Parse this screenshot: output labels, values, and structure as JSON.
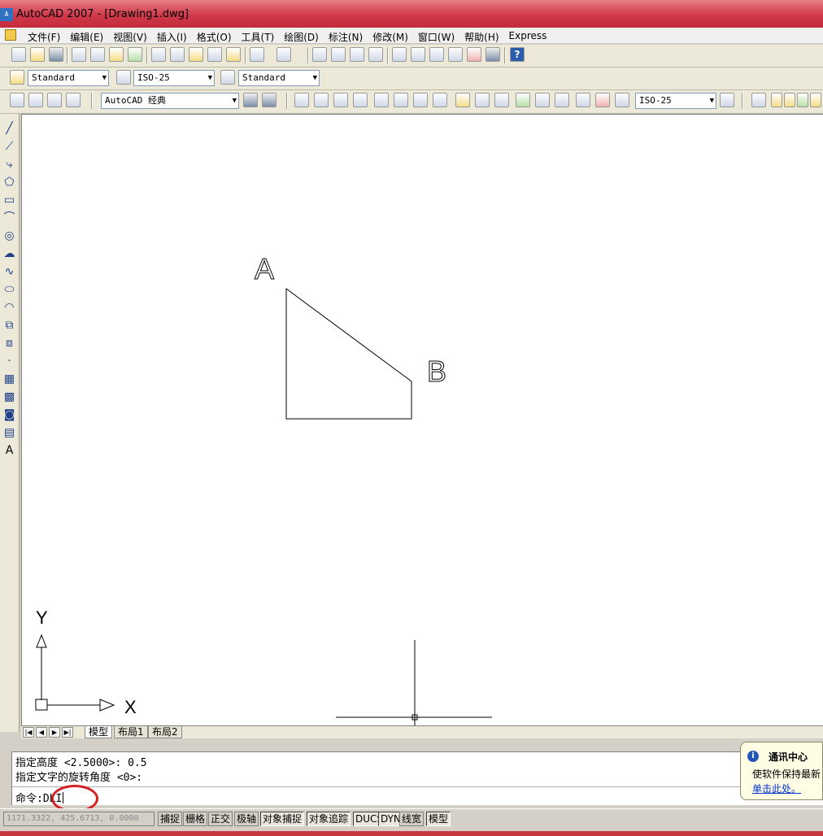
{
  "window": {
    "title": "AutoCAD 2007 - [Drawing1.dwg]",
    "app_icon_text": "A"
  },
  "menu": [
    "文件(F)",
    "编辑(E)",
    "视图(V)",
    "插入(I)",
    "格式(O)",
    "工具(T)",
    "绘图(D)",
    "标注(N)",
    "修改(M)",
    "窗口(W)",
    "帮助(H)",
    "Express"
  ],
  "styles_toolbar": {
    "text_style": "Standard",
    "dim_style": "ISO-25",
    "table_style": "Standard"
  },
  "workspace_toolbar": {
    "workspace": "AutoCAD 经典",
    "dim_style": "ISO-25"
  },
  "help_icon": "?",
  "left_tools": [
    "line-icon",
    "construction-line-icon",
    "polyline-icon",
    "polygon-icon",
    "rectangle-icon",
    "arc-icon",
    "circle-icon",
    "revcloud-icon",
    "spline-icon",
    "ellipse-icon",
    "ellipse-arc-icon",
    "insert-block-icon",
    "make-block-icon",
    "point-icon",
    "hatch-icon",
    "gradient-icon",
    "region-icon",
    "table-icon",
    "text-icon"
  ],
  "left_tool_text": "A",
  "drawing": {
    "label_a": "A",
    "label_b": "B",
    "axis_x": "X",
    "axis_y": "Y"
  },
  "tabs": [
    "模型",
    "布局1",
    "布局2"
  ],
  "active_tab": "模型",
  "command": {
    "line1": "指定高度 <2.5000>: 0.5",
    "line2": "指定文字的旋转角度 <0>:",
    "prompt": "命令:",
    "input": "DLI"
  },
  "comm_center": {
    "title": "通讯中心",
    "message": "使软件保持最新",
    "link": "单击此处。"
  },
  "status": {
    "coords": "1171.3322, 425.6713, 0.0000",
    "buttons": [
      "捕捉",
      "栅格",
      "正交",
      "极轴",
      "对象捕捉",
      "对象追踪",
      "DUCS",
      "DYN",
      "线宽",
      "模型"
    ]
  },
  "colors": {
    "title_bar": "#d0394a",
    "canvas": "#ffffff",
    "highlight_ring": "#d42020"
  }
}
